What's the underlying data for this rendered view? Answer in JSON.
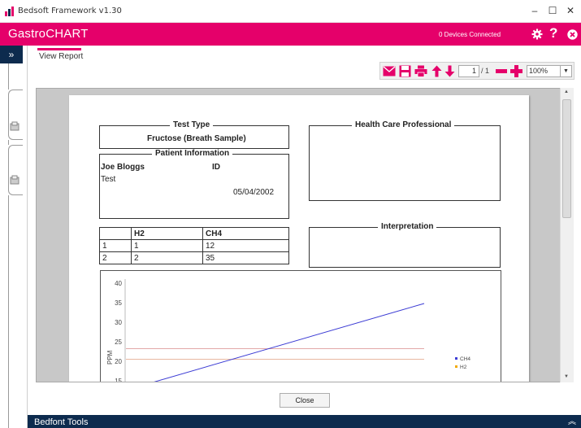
{
  "window": {
    "title": "Bedsoft Framework v1.30"
  },
  "app": {
    "name": "GastroCHART",
    "devices_status": "0 Devices Connected"
  },
  "tab": {
    "label": "View Report"
  },
  "toolbar": {
    "page_current": "1",
    "page_total": "/ 1",
    "zoom": "100%"
  },
  "report": {
    "test_type_legend": "Test Type",
    "test_type_value": "Fructose (Breath Sample)",
    "patient_legend": "Patient Information",
    "patient_name": "Joe Bloggs",
    "patient_extra": "Test",
    "id_label": "ID",
    "dob": "05/04/2002",
    "hcp_legend": "Health Care Professional",
    "interpretation_legend": "Interpretation",
    "table": {
      "headers": [
        "",
        "H2",
        "CH4"
      ],
      "rows": [
        [
          "1",
          "1",
          "12"
        ],
        [
          "2",
          "2",
          "35"
        ]
      ]
    }
  },
  "chart_data": {
    "type": "line",
    "ylabel": "PPM",
    "yticks": [
      "40",
      "35",
      "30",
      "25",
      "20",
      "15"
    ],
    "series": [
      {
        "name": "CH4",
        "color": "#3b3bd4"
      },
      {
        "name": "H2",
        "color": "#f2a900"
      }
    ]
  },
  "buttons": {
    "close": "Close"
  },
  "footer": {
    "tools_label": "Bedfont Tools"
  },
  "colors": {
    "brand": "#e5006a",
    "navy": "#0d2b4e"
  }
}
